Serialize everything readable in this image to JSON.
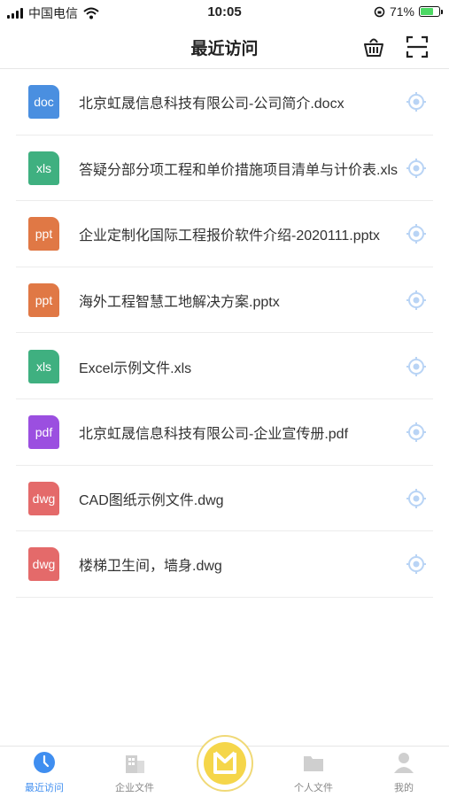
{
  "status_bar": {
    "carrier": "中国电信",
    "time": "10:05",
    "battery": "71%"
  },
  "header": {
    "title": "最近访问",
    "icons": [
      "basket-icon",
      "scan-icon"
    ]
  },
  "files": [
    {
      "type": "doc",
      "color": "#4a8fe0",
      "name": "北京虹晟信息科技有限公司-公司简介.docx"
    },
    {
      "type": "xls",
      "color": "#3fb080",
      "name": "答疑分部分项工程和单价措施项目清单与计价表.xls"
    },
    {
      "type": "ppt",
      "color": "#e07845",
      "name": "企业定制化国际工程报价软件介绍-2020111.pptx"
    },
    {
      "type": "ppt",
      "color": "#e07845",
      "name": "海外工程智慧工地解决方案.pptx"
    },
    {
      "type": "xls",
      "color": "#3fb080",
      "name": "Excel示例文件.xls"
    },
    {
      "type": "pdf",
      "color": "#9b4fe0",
      "name": "北京虹晟信息科技有限公司-企业宣传册.pdf"
    },
    {
      "type": "dwg",
      "color": "#e46a6a",
      "name": "CAD图纸示例文件.dwg"
    },
    {
      "type": "dwg",
      "color": "#e46a6a",
      "name": "楼梯卫生间，墙身.dwg"
    }
  ],
  "tabs": [
    {
      "label": "最近访问",
      "icon": "clock-icon",
      "active": true
    },
    {
      "label": "企业文件",
      "icon": "building-icon",
      "active": false
    },
    {
      "label": "",
      "icon": "home-logo-icon",
      "active": false
    },
    {
      "label": "个人文件",
      "icon": "folder-icon",
      "active": false
    },
    {
      "label": "我的",
      "icon": "person-icon",
      "active": false
    }
  ],
  "colors": {
    "accent": "#3f8ef0",
    "locate": "#b9d4f5",
    "logo": "#f5d64a"
  }
}
